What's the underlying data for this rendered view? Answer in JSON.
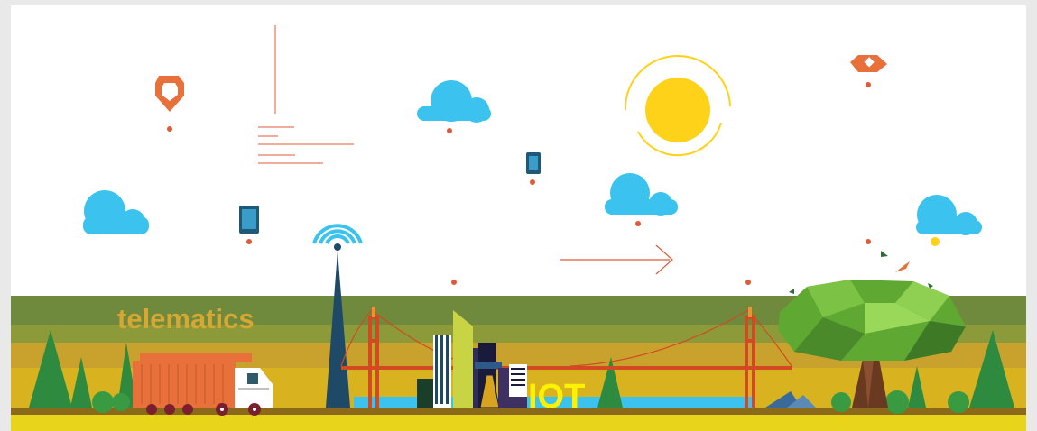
{
  "illustration": {
    "telematics_label": "telematics",
    "iot_label": "IOT",
    "colors": {
      "background": "#ffffff",
      "sky_line": "#e05a3a",
      "cloud": "#3cc2ee",
      "sun": "#ffd21a",
      "band_olive": "#6f8a3c",
      "band_mustard": "#c9a22e",
      "ground": "#d8b21f",
      "bridge": "#d24a22",
      "truck": "#e8703a",
      "tree": "#5fa832",
      "water": "#3cc2ee"
    },
    "icons": [
      "location-pin-icon",
      "diamond-pin-icon",
      "cloud-icon",
      "sun-icon",
      "tablet-icon",
      "wifi-tower-icon",
      "arrow-icon",
      "bird-icon",
      "tree-icon",
      "truck-icon",
      "bridge-icon"
    ]
  }
}
